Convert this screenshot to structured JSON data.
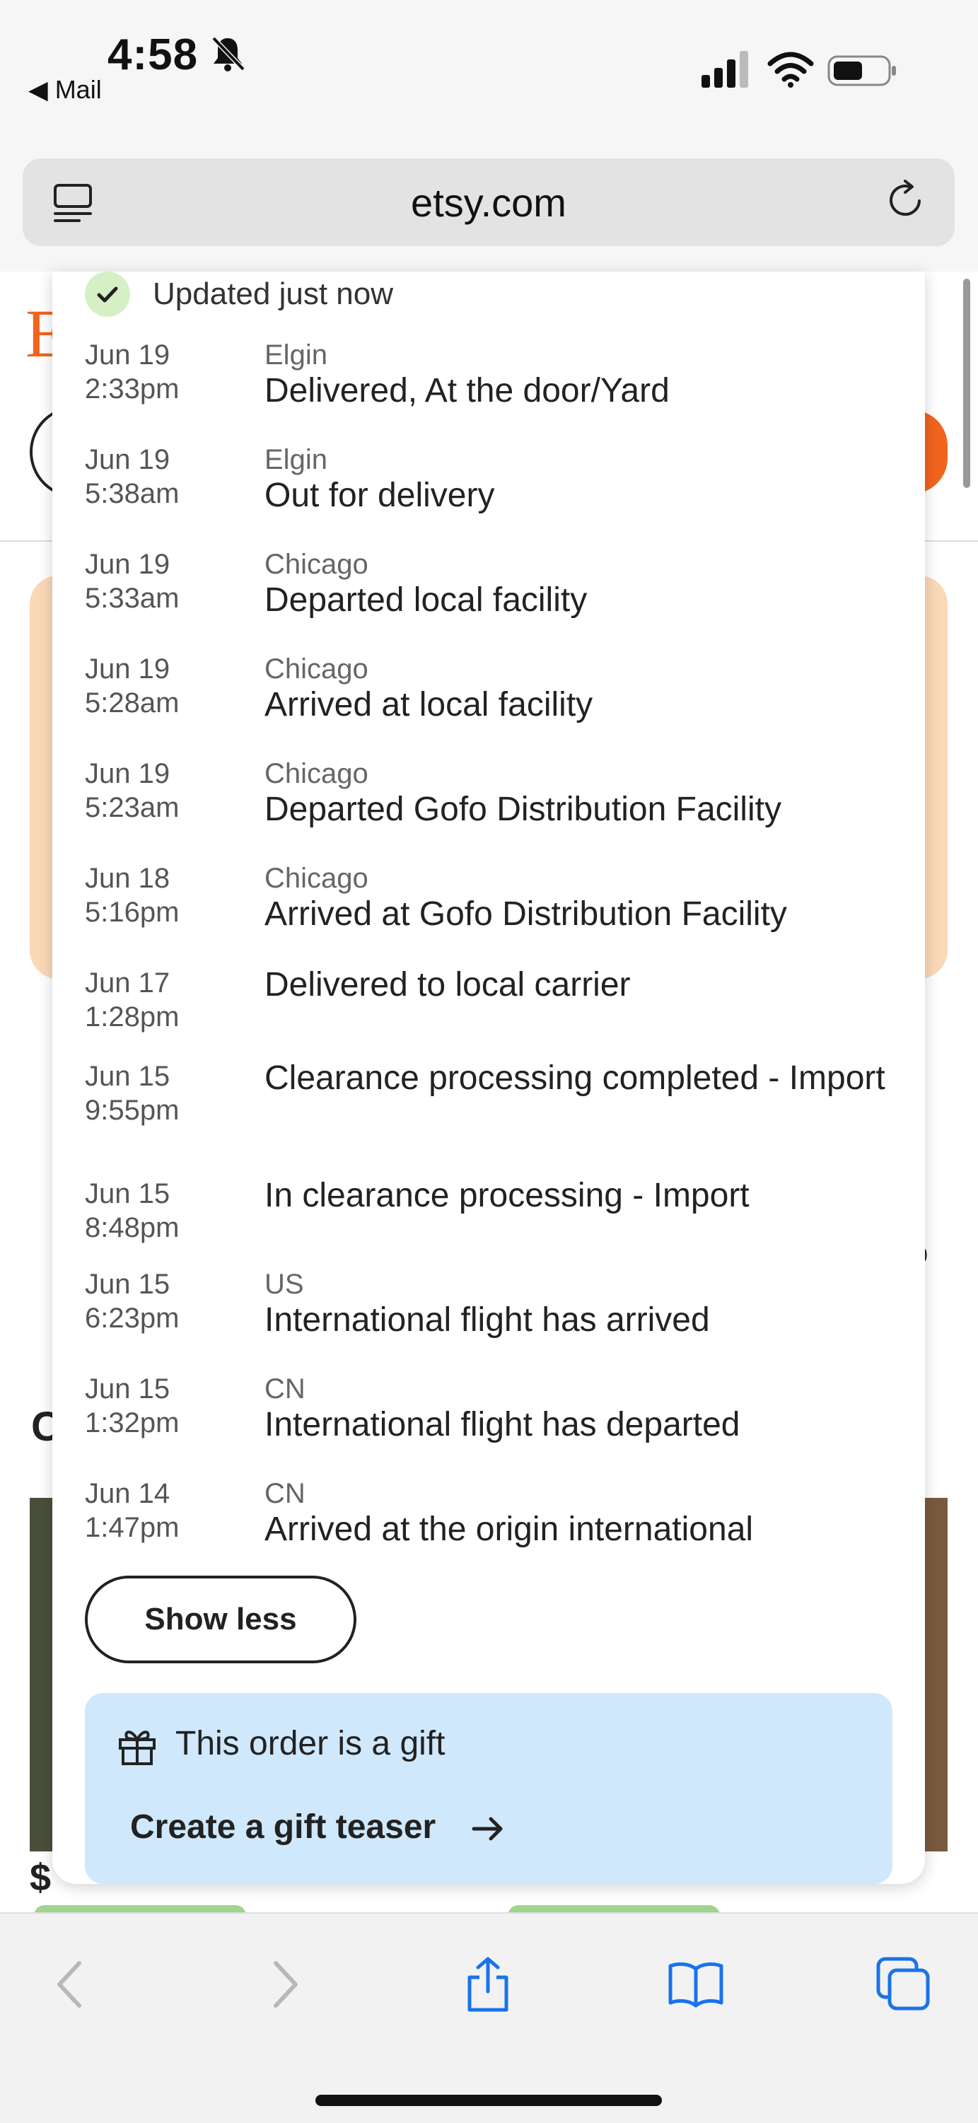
{
  "status_bar": {
    "time": "4:58",
    "back_label": "Mail",
    "icons": [
      "bell-slash-icon",
      "signal-icon",
      "wifi-icon",
      "battery-icon"
    ]
  },
  "url_bar": {
    "url": "etsy.com",
    "icons": [
      "reader-icon",
      "reload-icon"
    ]
  },
  "background_page": {
    "logo_letter": "E",
    "fragment_c": "C",
    "fragment_p": "p",
    "price_1": "$",
    "price_2": ""
  },
  "tracking": {
    "updated_text": "Updated just now",
    "events": [
      {
        "date": "Jun 19",
        "time": "2:33pm",
        "location": "Elgin",
        "description": "Delivered, At the door/Yard"
      },
      {
        "date": "Jun 19",
        "time": "5:38am",
        "location": "Elgin",
        "description": "Out for delivery"
      },
      {
        "date": "Jun 19",
        "time": "5:33am",
        "location": "Chicago",
        "description": "Departed local facility"
      },
      {
        "date": "Jun 19",
        "time": "5:28am",
        "location": "Chicago",
        "description": "Arrived at local facility"
      },
      {
        "date": "Jun 19",
        "time": "5:23am",
        "location": "Chicago",
        "description": "Departed Gofo Distribution Facility"
      },
      {
        "date": "Jun 18",
        "time": "5:16pm",
        "location": "Chicago",
        "description": "Arrived at Gofo Distribution Facility"
      },
      {
        "date": "Jun 17",
        "time": "1:28pm",
        "location": "",
        "description": "Delivered to local carrier"
      },
      {
        "date": "Jun 15",
        "time": "9:55pm",
        "location": "",
        "description": "Clearance processing completed - Import"
      },
      {
        "date": "Jun 15",
        "time": "8:48pm",
        "location": "",
        "description": "In clearance processing - Import"
      },
      {
        "date": "Jun 15",
        "time": "6:23pm",
        "location": "US",
        "description": "International flight has arrived"
      },
      {
        "date": "Jun 15",
        "time": "1:32pm",
        "location": "CN",
        "description": "International flight has departed"
      },
      {
        "date": "Jun 14",
        "time": "1:47pm",
        "location": "CN",
        "description": "Arrived at the origin international"
      }
    ],
    "show_less_label": "Show less"
  },
  "gift": {
    "text": "This order is a gift",
    "link_label": "Create a gift teaser"
  },
  "toolbar": {
    "icons": [
      "back-icon",
      "forward-icon",
      "share-icon",
      "bookmarks-icon",
      "tabs-icon"
    ]
  },
  "colors": {
    "etsy_orange": "#f1641e",
    "gift_bg": "#cfe8fb",
    "check_bg": "#d5f0c5",
    "safari_blue": "#1a73e8"
  }
}
